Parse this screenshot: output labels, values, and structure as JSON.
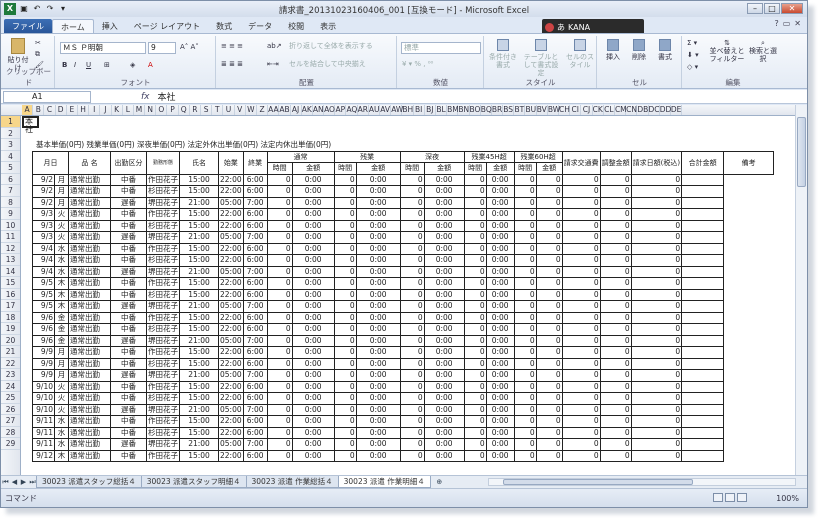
{
  "window": {
    "title": "請求書_20131023160406_001  [互換モード]  -  Microsoft Excel",
    "min": "–",
    "max": "□",
    "close": "✕"
  },
  "ime": {
    "label": "あ",
    "mode": "KANA"
  },
  "tabs": [
    "ファイル",
    "ホーム",
    "挿入",
    "ページ レイアウト",
    "数式",
    "データ",
    "校閲",
    "表示"
  ],
  "ribbon": {
    "clipboard": {
      "paste": "貼り付け",
      "label": "クリップボード"
    },
    "font": {
      "name": "ＭＳ Ｐ明朝",
      "size": "9",
      "label": "フォント"
    },
    "alignment": {
      "wrap": "折り返して全体を表示する",
      "merge": "セルを結合して中央揃え",
      "label": "配置"
    },
    "number": {
      "format": "標準",
      "label": "数値"
    },
    "style": {
      "cond": "条件付き書式",
      "table": "テーブルとして書式設定",
      "cell": "セルのスタイル",
      "label": "スタイル"
    },
    "cells": {
      "insert": "挿入",
      "delete": "削除",
      "format": "書式",
      "label": "セル"
    },
    "edit": {
      "sort": "並べ替えとフィルター",
      "find": "検索と選択",
      "label": "編集"
    }
  },
  "formula_bar": {
    "namebox": "A1",
    "fx": "fx",
    "value": "本社"
  },
  "columns": [
    "A",
    "B",
    "C",
    "D",
    "E",
    "H",
    "I",
    "J",
    "K",
    "L",
    "M",
    "N",
    "O",
    "P",
    "Q",
    "R",
    "S",
    "T",
    "U",
    "V",
    "W",
    "Z",
    "AA",
    "AB",
    "AJ",
    "AK",
    "AN",
    "AO",
    "AP",
    "AQ",
    "AR",
    "AU",
    "AV",
    "AW",
    "BH",
    "BI",
    "BJ",
    "BL",
    "BM",
    "BN",
    "BO",
    "BQ",
    "BR",
    "BS",
    "BT",
    "BU",
    "BV",
    "BW",
    "CH",
    "CI",
    "CJ",
    "CK",
    "CL",
    "CM",
    "CN",
    "DB",
    "DC",
    "DD",
    "DE"
  ],
  "rows": [
    "1",
    "2",
    "3",
    "4",
    "5",
    "6",
    "7",
    "8",
    "9",
    "10",
    "11",
    "12",
    "13",
    "14",
    "15",
    "16",
    "17",
    "18",
    "19",
    "20",
    "21",
    "22",
    "23",
    "24",
    "25",
    "26",
    "27",
    "28",
    "29"
  ],
  "cell_a1": "本社",
  "summary_line": "基本単価(0円)  残業単価(0円)  深夜単価(0円)  法定外休出単価(0円)  法定内休出単価(0円)",
  "header1": [
    "月日",
    "品 名",
    "出勤区分",
    "勤務形態",
    "氏名",
    "始業",
    "終業",
    "通常",
    "残業",
    "深夜",
    "残業45H超",
    "残業60H超",
    "請求交通費",
    "調整金額",
    "請求日額(税込)",
    "合計金額",
    "備考"
  ],
  "header2": [
    "時間",
    "金額"
  ],
  "rows_data": [
    {
      "d": "9/2",
      "w": "月",
      "k": "通常出勤",
      "t": "中番",
      "n": "作田花子",
      "s": "15:00",
      "e": "22:00",
      "h": "6:00"
    },
    {
      "d": "9/2",
      "w": "月",
      "k": "通常出勤",
      "t": "中番",
      "n": "杉田花子",
      "s": "15:00",
      "e": "22:00",
      "h": "6:00"
    },
    {
      "d": "9/2",
      "w": "月",
      "k": "通常出勤",
      "t": "遅番",
      "n": "堺田花子",
      "s": "21:00",
      "e": "05:00",
      "h": "7:00"
    },
    {
      "d": "9/3",
      "w": "火",
      "k": "通常出勤",
      "t": "中番",
      "n": "作田花子",
      "s": "15:00",
      "e": "22:00",
      "h": "6:00"
    },
    {
      "d": "9/3",
      "w": "火",
      "k": "通常出勤",
      "t": "中番",
      "n": "杉田花子",
      "s": "15:00",
      "e": "22:00",
      "h": "6:00"
    },
    {
      "d": "9/3",
      "w": "火",
      "k": "通常出勤",
      "t": "遅番",
      "n": "堺田花子",
      "s": "21:00",
      "e": "05:00",
      "h": "7:00"
    },
    {
      "d": "9/4",
      "w": "水",
      "k": "通常出勤",
      "t": "中番",
      "n": "作田花子",
      "s": "15:00",
      "e": "22:00",
      "h": "6:00"
    },
    {
      "d": "9/4",
      "w": "水",
      "k": "通常出勤",
      "t": "中番",
      "n": "杉田花子",
      "s": "15:00",
      "e": "22:00",
      "h": "6:00"
    },
    {
      "d": "9/4",
      "w": "水",
      "k": "通常出勤",
      "t": "遅番",
      "n": "堺田花子",
      "s": "21:00",
      "e": "05:00",
      "h": "7:00"
    },
    {
      "d": "9/5",
      "w": "木",
      "k": "通常出勤",
      "t": "中番",
      "n": "作田花子",
      "s": "15:00",
      "e": "22:00",
      "h": "6:00"
    },
    {
      "d": "9/5",
      "w": "木",
      "k": "通常出勤",
      "t": "中番",
      "n": "杉田花子",
      "s": "15:00",
      "e": "22:00",
      "h": "6:00"
    },
    {
      "d": "9/5",
      "w": "木",
      "k": "通常出勤",
      "t": "遅番",
      "n": "堺田花子",
      "s": "21:00",
      "e": "05:00",
      "h": "7:00"
    },
    {
      "d": "9/6",
      "w": "金",
      "k": "通常出勤",
      "t": "中番",
      "n": "作田花子",
      "s": "15:00",
      "e": "22:00",
      "h": "6:00"
    },
    {
      "d": "9/6",
      "w": "金",
      "k": "通常出勤",
      "t": "中番",
      "n": "杉田花子",
      "s": "15:00",
      "e": "22:00",
      "h": "6:00"
    },
    {
      "d": "9/6",
      "w": "金",
      "k": "通常出勤",
      "t": "遅番",
      "n": "堺田花子",
      "s": "21:00",
      "e": "05:00",
      "h": "7:00"
    },
    {
      "d": "9/9",
      "w": "月",
      "k": "通常出勤",
      "t": "中番",
      "n": "作田花子",
      "s": "15:00",
      "e": "22:00",
      "h": "6:00"
    },
    {
      "d": "9/9",
      "w": "月",
      "k": "通常出勤",
      "t": "中番",
      "n": "杉田花子",
      "s": "15:00",
      "e": "22:00",
      "h": "6:00"
    },
    {
      "d": "9/9",
      "w": "月",
      "k": "通常出勤",
      "t": "遅番",
      "n": "堺田花子",
      "s": "21:00",
      "e": "05:00",
      "h": "7:00"
    },
    {
      "d": "9/10",
      "w": "火",
      "k": "通常出勤",
      "t": "中番",
      "n": "作田花子",
      "s": "15:00",
      "e": "22:00",
      "h": "6:00"
    },
    {
      "d": "9/10",
      "w": "火",
      "k": "通常出勤",
      "t": "中番",
      "n": "杉田花子",
      "s": "15:00",
      "e": "22:00",
      "h": "6:00"
    },
    {
      "d": "9/10",
      "w": "火",
      "k": "通常出勤",
      "t": "遅番",
      "n": "堺田花子",
      "s": "21:00",
      "e": "05:00",
      "h": "7:00"
    },
    {
      "d": "9/11",
      "w": "水",
      "k": "通常出勤",
      "t": "中番",
      "n": "作田花子",
      "s": "15:00",
      "e": "22:00",
      "h": "6:00"
    },
    {
      "d": "9/11",
      "w": "水",
      "k": "通常出勤",
      "t": "中番",
      "n": "杉田花子",
      "s": "15:00",
      "e": "22:00",
      "h": "6:00"
    },
    {
      "d": "9/11",
      "w": "水",
      "k": "通常出勤",
      "t": "遅番",
      "n": "堺田花子",
      "s": "21:00",
      "e": "05:00",
      "h": "7:00"
    },
    {
      "d": "9/12",
      "w": "木",
      "k": "通常出勤",
      "t": "中番",
      "n": "作田花子",
      "s": "15:00",
      "e": "22:00",
      "h": "6:00"
    }
  ],
  "zero_time": "0:00",
  "zero": "0",
  "sheet_tabs": [
    "30023 派遣スタッフ総括４",
    "30023 派遣スタッフ明細４",
    "30023 派遣 作業総括４",
    "30023 派遣 作業明細４"
  ],
  "status": {
    "mode": "コマンド",
    "zoom": "100%"
  }
}
